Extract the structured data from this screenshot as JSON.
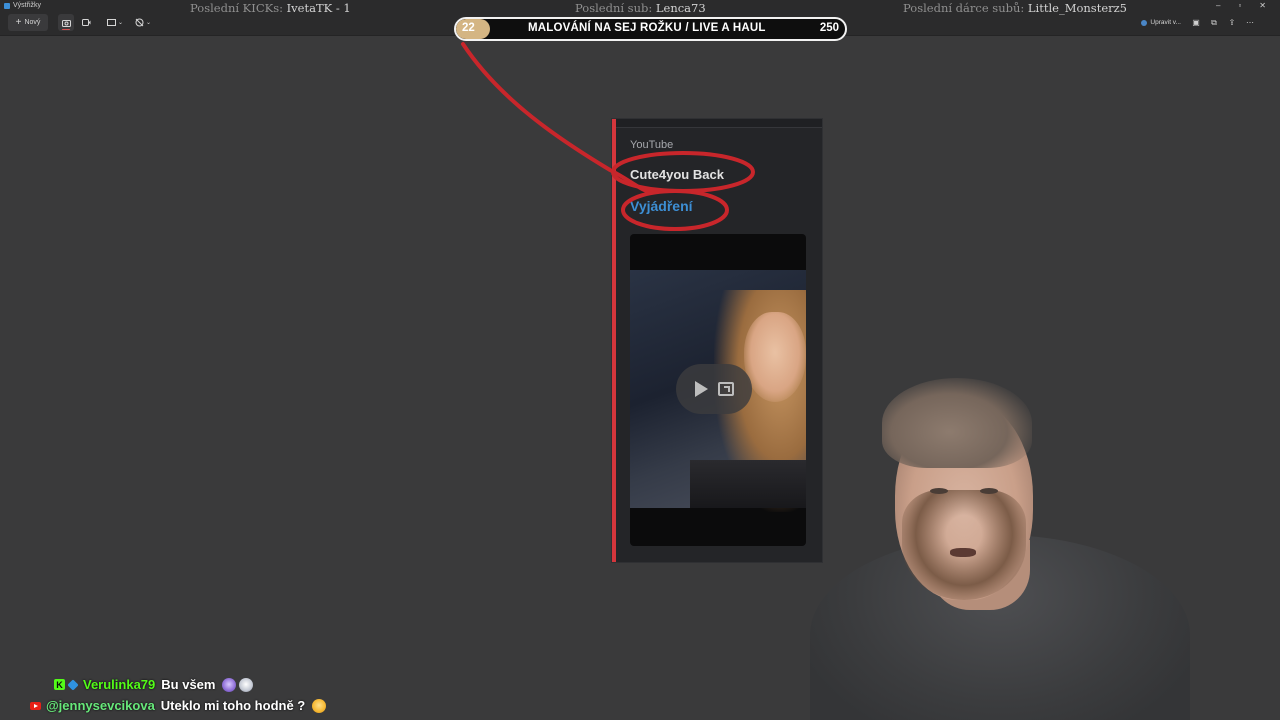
{
  "app": {
    "window_title": "Výstřižky",
    "new_button_label": "Nový",
    "edit_button_label": "Upravit v..."
  },
  "overlay": {
    "kicks_label": "Poslední KICKs:",
    "kicks_value": "IvetaTK - 1",
    "sub_label": "Poslední sub:",
    "sub_value": "Lenca73",
    "donor_label": "Poslední dárce subů:",
    "donor_value": "Little_Monsterz5"
  },
  "goal": {
    "current": "22",
    "title": "MALOVÁNÍ NA SEJ ROŽKU / LIVE A HAUL",
    "target": "250",
    "progress_fraction": 0.088,
    "fill_color": "#d4b583"
  },
  "snip": {
    "provider": "YouTube",
    "author": "Cute4you Back",
    "video_title": "Vyjádření",
    "accent_color": "#d4363c",
    "link_color": "#3d8fd5"
  },
  "chat": [
    {
      "platform": "kick",
      "user": "Verulinka79",
      "text": "Bu všem",
      "emojis": [
        "a",
        "b"
      ]
    },
    {
      "platform": "youtube",
      "user": "@jennysevcikova",
      "text": "Uteklo mi toho hodně ?",
      "emojis": [
        "c"
      ]
    }
  ],
  "colors": {
    "annotation_red": "#c8262b",
    "background": "#3a3a3b"
  }
}
